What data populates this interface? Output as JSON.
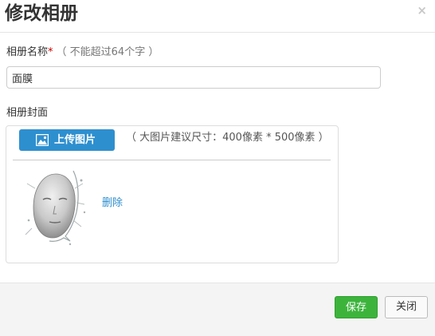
{
  "dialog": {
    "title": "修改相册",
    "close_symbol": "×"
  },
  "form": {
    "name_label": "相册名称",
    "required_mark": "*",
    "name_hint": "（ 不能超过64个字 ）",
    "name_value": "面膜",
    "cover_label": "相册封面",
    "upload_button_label": "上传图片",
    "upload_icon": "image-icon",
    "upload_hint": "（ 大图片建议尺寸：400像素 * 500像素 ）",
    "delete_label": "删除"
  },
  "footer": {
    "save_label": "保存",
    "close_label": "关闭"
  },
  "colors": {
    "primary": "#2e8fcf",
    "save_green": "#3cb43c",
    "required_red": "#cc0000"
  }
}
